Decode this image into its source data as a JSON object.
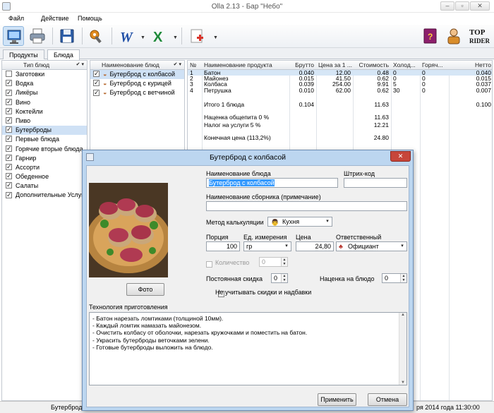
{
  "window": {
    "title": "Olla 2.13 - Бар \"Небо\""
  },
  "menu": [
    "Файл",
    "Действие",
    "Помощь"
  ],
  "tabs": [
    "Продукты",
    "Блюда"
  ],
  "categories": {
    "header": "Тип блюд",
    "items": [
      "Заготовки",
      "Водка",
      "Ликёры",
      "Вино",
      "Коктейли",
      "Пиво",
      "Бутерброды",
      "Первые блюда",
      "Горячие вторые блюда",
      "Гарнир",
      "Ассорти",
      "Обеденное",
      "Салаты",
      "Дополнительные Услуги"
    ],
    "checked": [
      false,
      true,
      true,
      true,
      true,
      true,
      true,
      true,
      true,
      true,
      true,
      true,
      true,
      true
    ],
    "selected_index": 6
  },
  "dishes": {
    "header": "Наименование блюд",
    "items": [
      "Бутерброд с колбасой",
      "Бутерброд с курицей",
      "Бутерброд с ветчиной"
    ],
    "selected_index": 0
  },
  "grid": {
    "columns": [
      "№",
      "Наименование продукта",
      "Брутто",
      "Цена за 1 ...",
      "Стоимость",
      "Холод...",
      "Горяч...",
      "Нетто"
    ],
    "rows": [
      [
        "1",
        "Батон",
        "0.040",
        "12.00",
        "0.48",
        "0",
        "0",
        "0.040"
      ],
      [
        "2",
        "Майонез",
        "0.015",
        "41.50",
        "0.62",
        "0",
        "0",
        "0.015"
      ],
      [
        "3",
        "Колбаса",
        "0.039",
        "254.00",
        "9.91",
        "5",
        "0",
        "0.037"
      ],
      [
        "4",
        "Петрушка",
        "0.010",
        "62.00",
        "0.62",
        "30",
        "0",
        "0.007"
      ]
    ],
    "total": {
      "label": "Итого 1 блюда",
      "brutto": "0.104",
      "cost": "11.63",
      "netto": "0.100"
    },
    "markup": {
      "label": "Наценка общепита 0 %",
      "value": "11.63"
    },
    "tax": {
      "label": "Налог на услуги 5 %",
      "value": "12.21"
    },
    "final": {
      "label": "Конечная цена (113,2%)",
      "value": "24.80"
    }
  },
  "status": {
    "left": "Бутерброд",
    "right": "ря 2014 года  11:30:00"
  },
  "dialog": {
    "title": "Бутерброд с колбасой",
    "name_label": "Наименование блюда",
    "name_value": "Бутерброд с колбасой",
    "barcode_label": "Штрих-код",
    "barcode_value": "",
    "collection_label": "Наименование сборника (примечание)",
    "collection_value": "",
    "calc_method_label": "Метод калькуляции",
    "calc_method_value": "Кухня",
    "portion_label": "Порция",
    "portion_value": "100",
    "unit_label": "Ед. измерения",
    "unit_value": "гр",
    "price_label": "Цена",
    "price_value": "24,80",
    "responsible_label": "Ответственный",
    "responsible_value": "Официант",
    "quantity_label": "Количество",
    "quantity_value": "0",
    "discount_label": "Постоянная скидка",
    "discount_value": "0",
    "markup_label": "Наценка на блюдо",
    "markup_value": "0",
    "ignore_label": "Не учитывать скидки и надбавки",
    "photo_button": "Фото",
    "tech_label": "Технология приготовления",
    "tech_lines": [
      "- Батон нарезать ломтиками (толщиной 10мм).",
      "- Каждый ломтик намазать майонезом.",
      "- Очистить колбасу от оболочки, нарезать кружочками и поместить на батон.",
      "- Украсить бутерброды веточками зелени.",
      "- Готовые бутерброды выложить на блюдо."
    ],
    "apply_button": "Применить",
    "cancel_button": "Отмена"
  }
}
